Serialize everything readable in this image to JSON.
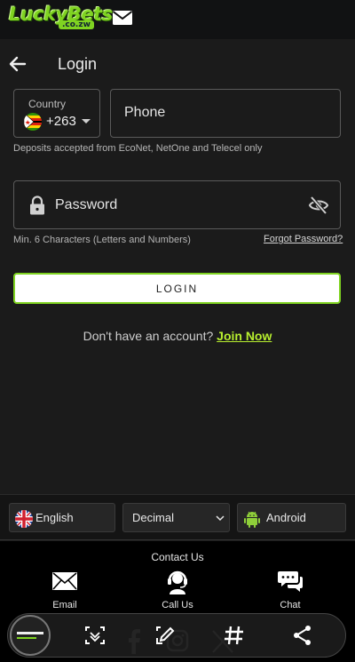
{
  "brand": {
    "logo_text": "LuckyBets",
    "logo_sub": ".co.zw",
    "accent": "#7fd321"
  },
  "header": {
    "title": "Login"
  },
  "country": {
    "label": "Country",
    "code": "+263"
  },
  "phone": {
    "placeholder": "Phone"
  },
  "deposit_hint": "Deposits accepted from EcoNet, NetOne and Telecel only",
  "password": {
    "placeholder": "Password"
  },
  "password_hint": "Min. 6 Characters (Letters and Numbers)",
  "forgot_label": "Forgot Password?",
  "login_label": "LOGIN",
  "signup": {
    "prompt": "Don't have an account?",
    "link": "Join Now"
  },
  "prefs": {
    "language": "English",
    "odds_format": "Decimal",
    "app": "Android"
  },
  "footer": {
    "contact_title": "Contact Us",
    "contacts": [
      {
        "label": "Email",
        "icon": "envelope-icon"
      },
      {
        "label": "Call Us",
        "icon": "headset-icon"
      },
      {
        "label": "Chat",
        "icon": "chat-bubbles-icon"
      }
    ],
    "social": [
      "facebook-icon",
      "instagram-icon",
      "x-icon"
    ]
  },
  "overlay_toolbar": {
    "icons": [
      "scan-icon",
      "edit-icon",
      "hashtag-icon",
      "share-icon"
    ]
  }
}
